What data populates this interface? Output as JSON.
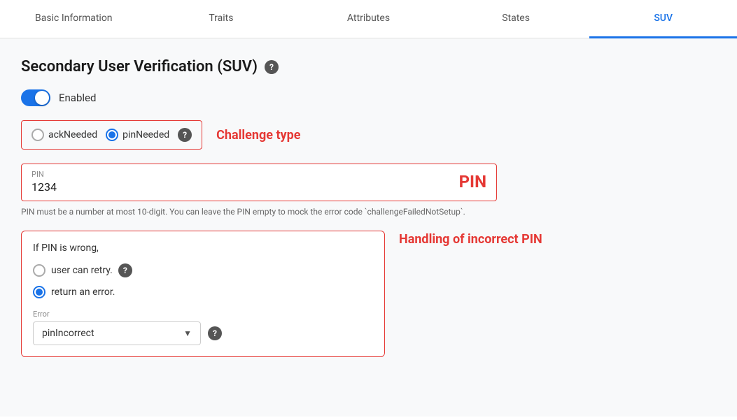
{
  "tabs": [
    {
      "id": "basic-information",
      "label": "Basic Information",
      "active": false
    },
    {
      "id": "traits",
      "label": "Traits",
      "active": false
    },
    {
      "id": "attributes",
      "label": "Attributes",
      "active": false
    },
    {
      "id": "states",
      "label": "States",
      "active": false
    },
    {
      "id": "suv",
      "label": "SUV",
      "active": true
    }
  ],
  "section": {
    "title": "Secondary User Verification (SUV)",
    "help_icon": "?"
  },
  "toggle": {
    "enabled": true,
    "label": "Enabled"
  },
  "challenge_type": {
    "label": "Challenge type",
    "options": [
      {
        "id": "ack-needed",
        "value": "ackNeeded",
        "selected": false
      },
      {
        "id": "pin-needed",
        "value": "pinNeeded",
        "selected": true
      }
    ],
    "help_icon": "?"
  },
  "pin": {
    "label": "PIN",
    "value": "1234",
    "display_label": "PIN",
    "hint": "PIN must be a number at most 10-digit. You can leave the PIN empty to mock the error code `challengeFailedNotSetup`."
  },
  "incorrect_pin": {
    "title": "If PIN is wrong,",
    "handling_label": "Handling of incorrect PIN",
    "options": [
      {
        "id": "retry",
        "label": "user can retry.",
        "selected": false,
        "has_help": true
      },
      {
        "id": "error",
        "label": "return an error.",
        "selected": true,
        "has_help": false
      }
    ],
    "error_dropdown": {
      "label": "Error",
      "value": "pinIncorrect",
      "help_icon": "?"
    }
  }
}
